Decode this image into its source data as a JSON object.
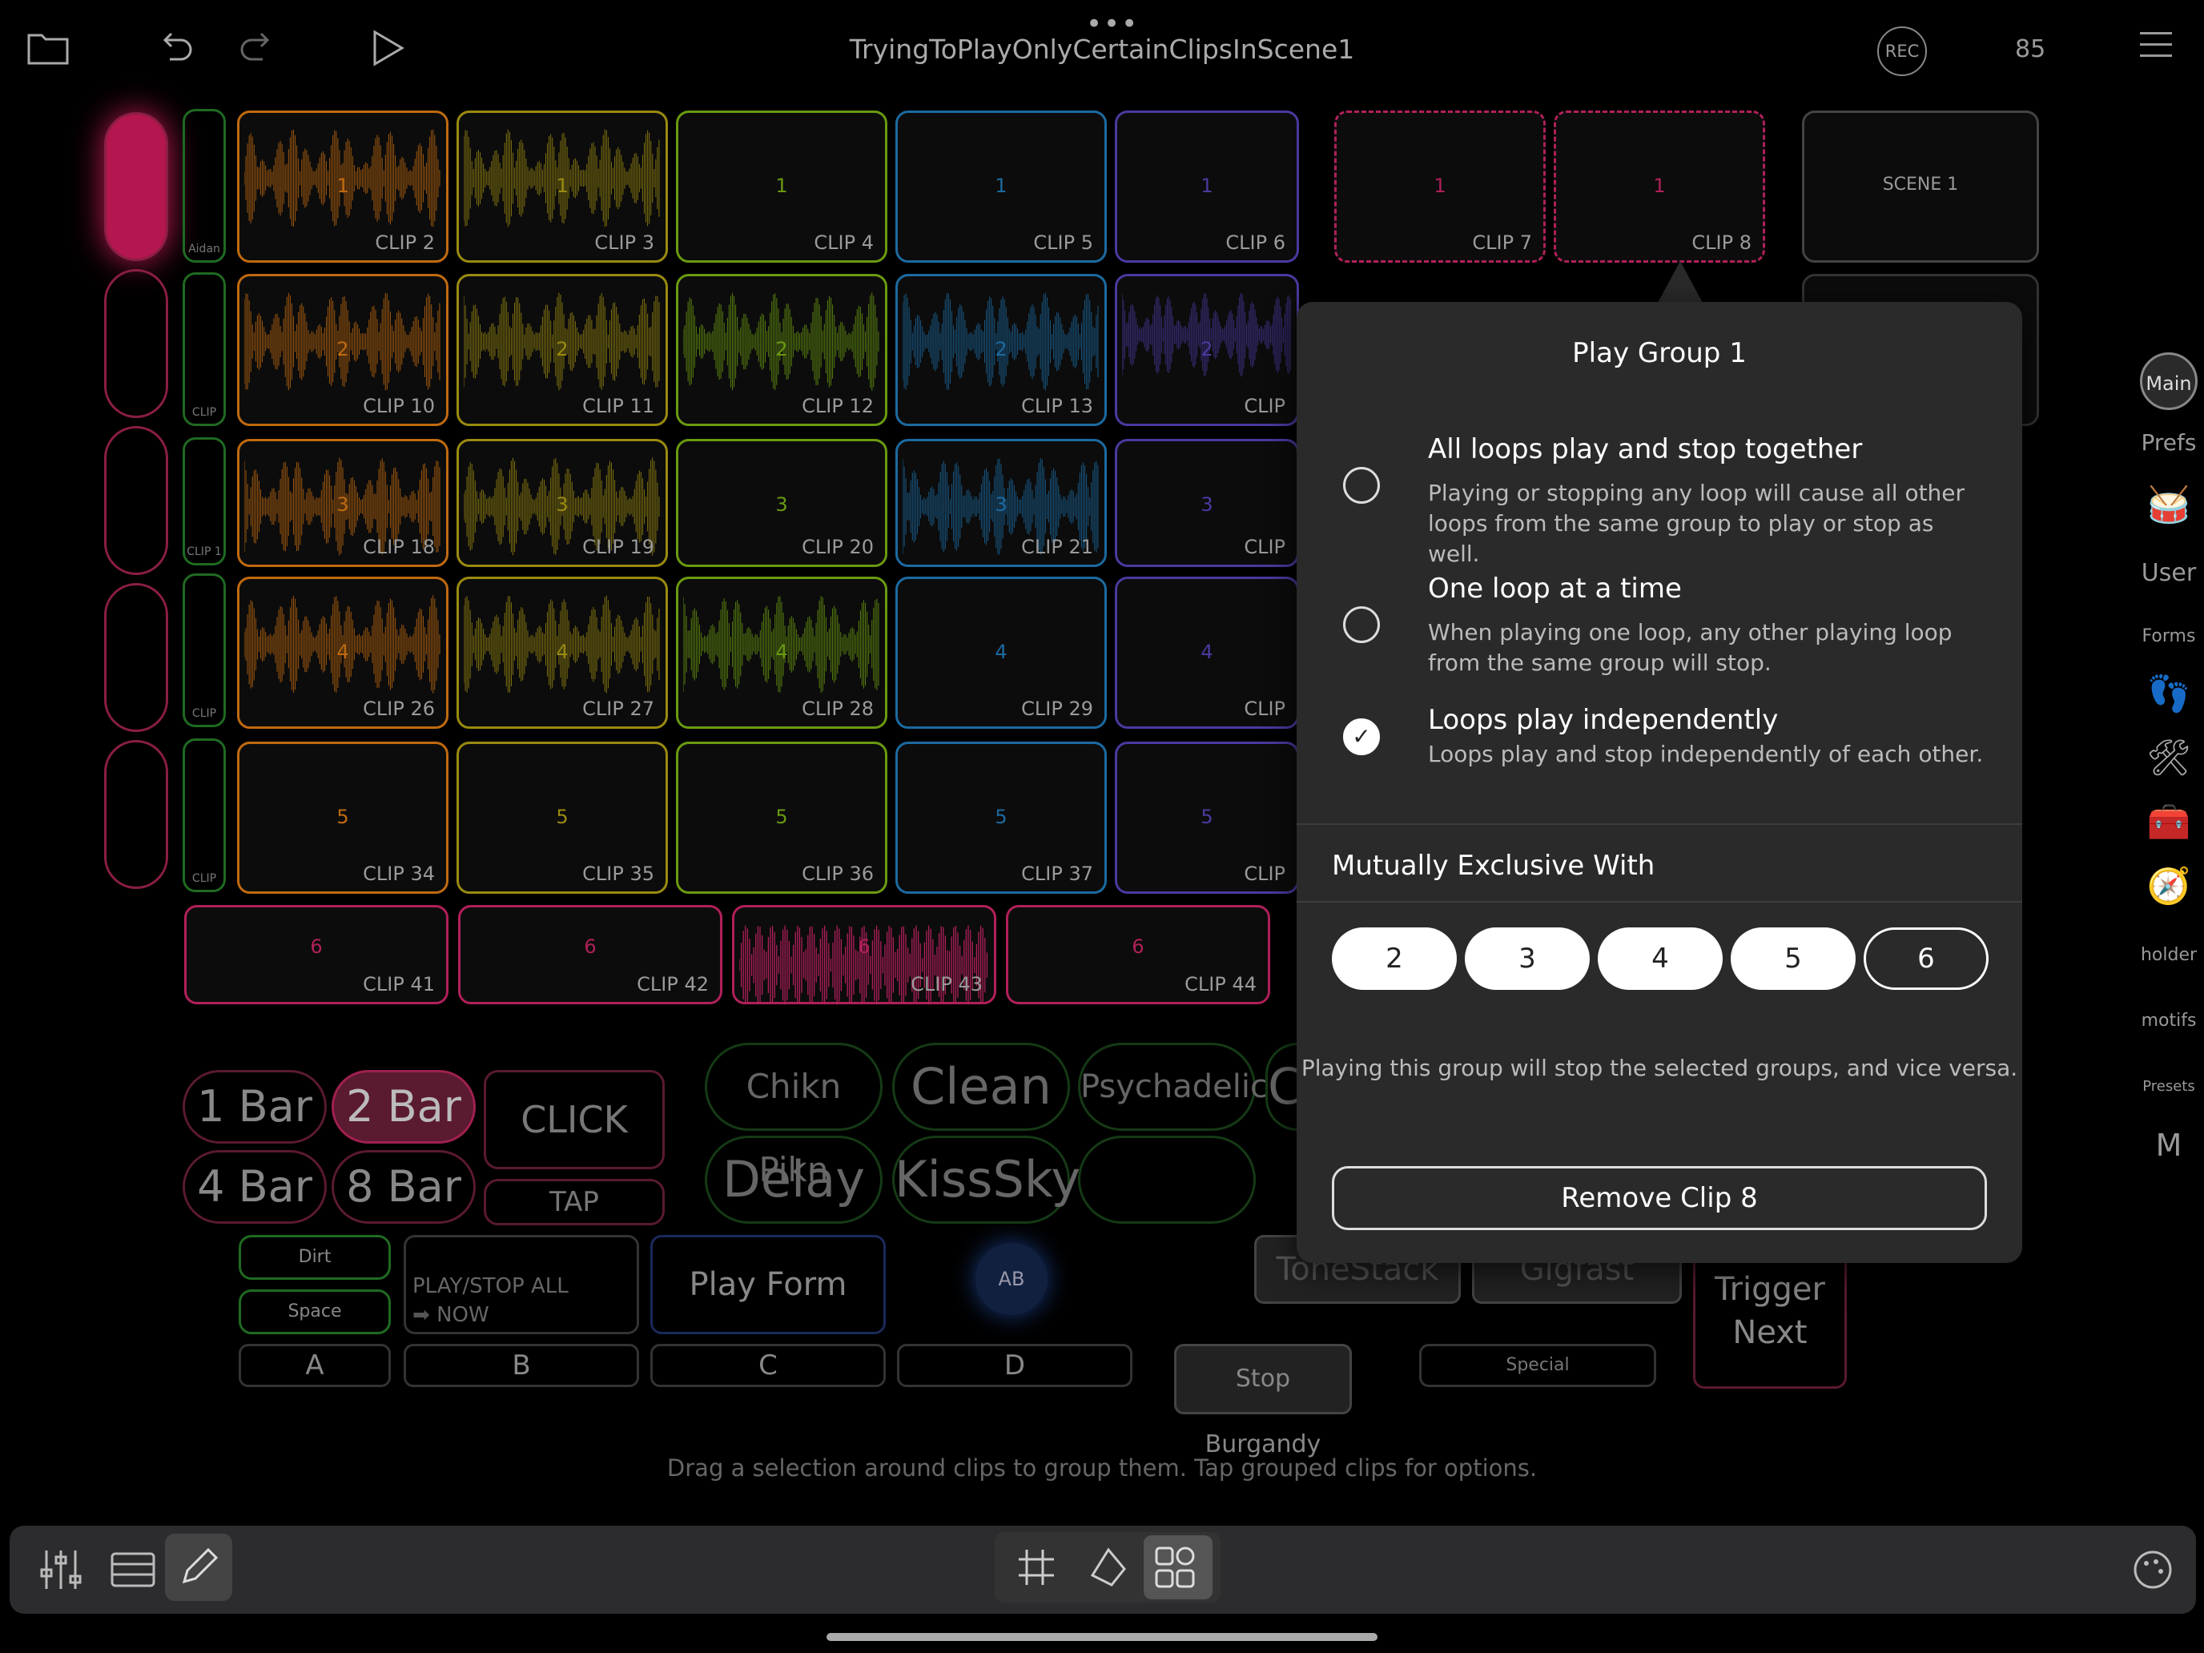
{
  "header": {
    "title": "TryingToPlayOnlyCertainClipsInScene1",
    "rec_label": "REC",
    "tempo": "85"
  },
  "grid": {
    "clips": [
      {
        "label": "CLIP 2",
        "num": "1"
      },
      {
        "label": "CLIP 3",
        "num": "1"
      },
      {
        "label": "CLIP 4",
        "num": "1"
      },
      {
        "label": "CLIP 5",
        "num": "1"
      },
      {
        "label": "CLIP 6",
        "num": "1"
      },
      {
        "label": "CLIP 7",
        "num": "1"
      },
      {
        "label": "CLIP 8",
        "num": "1"
      },
      {
        "label": "CLIP 10",
        "num": "2"
      },
      {
        "label": "CLIP 11",
        "num": "2"
      },
      {
        "label": "CLIP 12",
        "num": "2"
      },
      {
        "label": "CLIP 13",
        "num": "2"
      },
      {
        "label": "CLIP",
        "num": "2"
      },
      {
        "label": "CLIP 18",
        "num": "3"
      },
      {
        "label": "CLIP 19",
        "num": "3"
      },
      {
        "label": "CLIP 20",
        "num": "3"
      },
      {
        "label": "CLIP 21",
        "num": "3"
      },
      {
        "label": "CLIP",
        "num": "3"
      },
      {
        "label": "CLIP 26",
        "num": "4"
      },
      {
        "label": "CLIP 27",
        "num": "4"
      },
      {
        "label": "CLIP 28",
        "num": "4"
      },
      {
        "label": "CLIP 29",
        "num": "4"
      },
      {
        "label": "CLIP",
        "num": "4"
      },
      {
        "label": "CLIP 34",
        "num": "5"
      },
      {
        "label": "CLIP 35",
        "num": "5"
      },
      {
        "label": "CLIP 36",
        "num": "5"
      },
      {
        "label": "CLIP 37",
        "num": "5"
      },
      {
        "label": "CLIP",
        "num": "5"
      },
      {
        "label": "CLIP 41",
        "num": "6"
      },
      {
        "label": "CLIP 42",
        "num": "6"
      },
      {
        "label": "CLIP 43",
        "num": "6"
      },
      {
        "label": "CLIP 44",
        "num": "6"
      }
    ],
    "group_tags": [
      "Aidan",
      "CLIP",
      "CLIP 1",
      "CLIP",
      "CLIP"
    ],
    "scene_label": "SCENE 1"
  },
  "controls": {
    "bar_1": "1 Bar",
    "bar_2": "2 Bar",
    "bar_4": "4 Bar",
    "bar_8": "8 Bar",
    "click": "CLICK",
    "tap": "TAP",
    "presets": [
      "Chikn Pikn",
      "Clean",
      "Psychadelic",
      "C",
      "Delay",
      "KissSky"
    ],
    "dirt": "Dirt",
    "space": "Space",
    "play_stop_all": "PLAY/STOP ALL",
    "now": "NOW",
    "play_form": "Play Form",
    "ab": "AB",
    "tonestack": "ToneStack",
    "gigfast": "Gigfast",
    "trigger_next_1": "Trigger",
    "trigger_next_2": "Next",
    "a": "A",
    "b": "B",
    "c": "C",
    "d": "D",
    "stop_burgandy": "Stop Burgandy",
    "special": "Special"
  },
  "popover": {
    "title": "Play Group 1",
    "options": [
      {
        "title": "All loops play and stop together",
        "desc": "Playing or stopping any loop will cause all other loops from the same group to play or stop as well.",
        "checked": false
      },
      {
        "title": "One loop at a time",
        "desc": "When playing one loop, any other playing loop from the same group will stop.",
        "checked": false
      },
      {
        "title": "Loops play independently",
        "desc": "Loops play and stop independently of each other.",
        "checked": true
      }
    ],
    "mutually_exclusive_title": "Mutually Exclusive With",
    "groups": [
      {
        "label": "2",
        "selected": true
      },
      {
        "label": "3",
        "selected": true
      },
      {
        "label": "4",
        "selected": true
      },
      {
        "label": "5",
        "selected": true
      },
      {
        "label": "6",
        "selected": false
      }
    ],
    "note": "Playing this group will stop the selected groups, and vice versa.",
    "remove_label": "Remove Clip 8"
  },
  "sidebar": {
    "main": "Main",
    "prefs": "Prefs",
    "user": "User",
    "forms": "Forms",
    "holder": "holder",
    "motifs": "motifs",
    "presets": "Presets",
    "m": "M"
  },
  "hint": "Drag a selection around clips to group them. Tap grouped clips for options.",
  "colors": {
    "accent_pink": "#c41a55",
    "col_orange": "#c06a10",
    "col_yellow": "#9a8a10",
    "col_green": "#6a9a10",
    "col_blue": "#1c6aa0",
    "col_purple": "#4a3aa0",
    "col_magenta": "#b0205a"
  }
}
